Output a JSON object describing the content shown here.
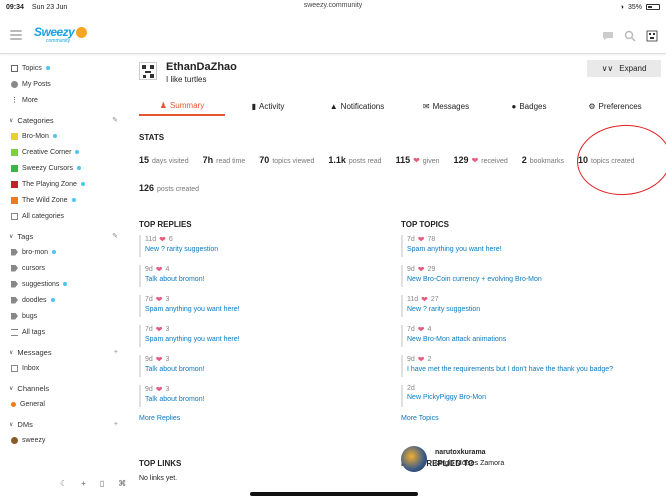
{
  "status": {
    "time": "09:34",
    "date": "Sun 23 Jun",
    "url": "sweezy.community",
    "battery": "35%"
  },
  "logo": {
    "text": "Sweezy",
    "sub": "community"
  },
  "sidebar": {
    "top": [
      {
        "label": "Topics",
        "dot": true
      },
      {
        "label": "My Posts",
        "dot": false
      },
      {
        "label": "More",
        "dot": false
      }
    ],
    "categories_title": "Categories",
    "categories": [
      {
        "label": "Bro-Mon",
        "color": "#e8d22a",
        "dot": true
      },
      {
        "label": "Creative Corner",
        "color": "#7fcf3a",
        "dot": true
      },
      {
        "label": "Sweezy Cursors",
        "color": "#3ab54a",
        "dot": true
      },
      {
        "label": "The Playing Zone",
        "color": "#c4202a",
        "dot": true
      },
      {
        "label": "The Wild Zone",
        "color": "#f07a18",
        "dot": true
      },
      {
        "label": "All categories",
        "color": "",
        "dot": false
      }
    ],
    "tags_title": "Tags",
    "tags": [
      {
        "label": "bro-mon",
        "dot": true
      },
      {
        "label": "cursors",
        "dot": false
      },
      {
        "label": "suggestions",
        "dot": true
      },
      {
        "label": "doodles",
        "dot": true
      },
      {
        "label": "bugs",
        "dot": false
      },
      {
        "label": "All tags",
        "dot": false
      }
    ],
    "messages_title": "Messages",
    "messages": [
      {
        "label": "Inbox"
      }
    ],
    "channels_title": "Channels",
    "channels": [
      {
        "label": "General"
      }
    ],
    "dms_title": "DMs",
    "dms": [
      {
        "label": "sweezy"
      }
    ]
  },
  "profile": {
    "username": "EthanDaZhao",
    "title": "I like turtles",
    "expand": "Expand"
  },
  "tabs": [
    "Summary",
    "Activity",
    "Notifications",
    "Messages",
    "Badges",
    "Preferences"
  ],
  "stats": {
    "title": "STATS",
    "items": [
      {
        "value": "15",
        "label": "days visited",
        "heart": false
      },
      {
        "value": "7h",
        "label": "read time",
        "heart": false
      },
      {
        "value": "70",
        "label": "topics viewed",
        "heart": false
      },
      {
        "value": "1.1k",
        "label": "posts read",
        "heart": false
      },
      {
        "value": "115",
        "label": "given",
        "heart": true
      },
      {
        "value": "129",
        "label": "received",
        "heart": true
      },
      {
        "value": "2",
        "label": "bookmarks",
        "heart": false
      },
      {
        "value": "10",
        "label": "topics created",
        "heart": false
      }
    ],
    "row2": [
      {
        "value": "126",
        "label": "posts created"
      }
    ]
  },
  "top_replies": {
    "title": "TOP REPLIES",
    "items": [
      {
        "date": "11d",
        "likes": "6",
        "title": "New ? rarity suggestion"
      },
      {
        "date": "9d",
        "likes": "4",
        "title": "Talk about bromon!"
      },
      {
        "date": "7d",
        "likes": "3",
        "title": "Spam anything you want here!"
      },
      {
        "date": "7d",
        "likes": "3",
        "title": "Spam anything you want here!"
      },
      {
        "date": "9d",
        "likes": "3",
        "title": "Talk about bromon!"
      },
      {
        "date": "9d",
        "likes": "3",
        "title": "Talk about bromon!"
      }
    ],
    "more": "More Replies"
  },
  "top_topics": {
    "title": "TOP TOPICS",
    "items": [
      {
        "date": "7d",
        "likes": "78",
        "title": "Spam anything you want here!"
      },
      {
        "date": "9d",
        "likes": "29",
        "title": "New Bro-Coin currency + evolving Bro-Mon"
      },
      {
        "date": "11d",
        "likes": "27",
        "title": "New ? rarity suggestion"
      },
      {
        "date": "7d",
        "likes": "4",
        "title": "New Bro-Mon attack animations"
      },
      {
        "date": "9d",
        "likes": "2",
        "title": "I have met the requirements but I don't have the thank you badge?"
      },
      {
        "date": "2d",
        "likes": "",
        "title": "New PickyPiggy Bro-Mon"
      }
    ],
    "more": "More Topics"
  },
  "top_links": {
    "title": "TOP LINKS",
    "empty": "No links yet."
  },
  "most_replied": {
    "title": "MOST REPLIED TO",
    "name": "narutoxkurama",
    "sub": "sergio Moises Zamora"
  }
}
